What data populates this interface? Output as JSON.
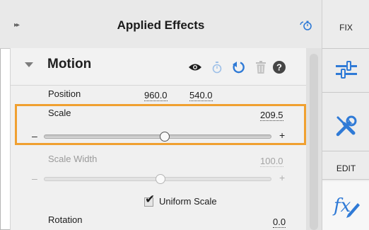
{
  "header": {
    "title": "Applied Effects",
    "collapse_glyph": "▸▸",
    "timer_icon": "stopwatch-icon"
  },
  "rail": {
    "fix_label": "FIX",
    "edit_label": "EDIT",
    "tools": [
      "adjustments-sliders-icon",
      "tools-wrench-screwdriver-icon",
      "fx-effects-icon"
    ],
    "accent_color": "#2f7ad6"
  },
  "motion": {
    "title": "Motion",
    "icons": [
      "eye-icon",
      "stopwatch-icon",
      "reset-icon",
      "trash-icon",
      "help-icon"
    ]
  },
  "position": {
    "label": "Position",
    "x": "960.0",
    "y": "540.0"
  },
  "scale": {
    "label": "Scale",
    "value": "209.5",
    "minus": "–",
    "plus": "+",
    "highlight_color": "#f0a030"
  },
  "scale_width": {
    "label": "Scale Width",
    "value": "100.0",
    "minus": "–",
    "plus": "+"
  },
  "uniform_scale": {
    "label": "Uniform Scale",
    "checked": true,
    "check_glyph": "✔"
  },
  "rotation": {
    "label": "Rotation",
    "value": "0.0"
  }
}
